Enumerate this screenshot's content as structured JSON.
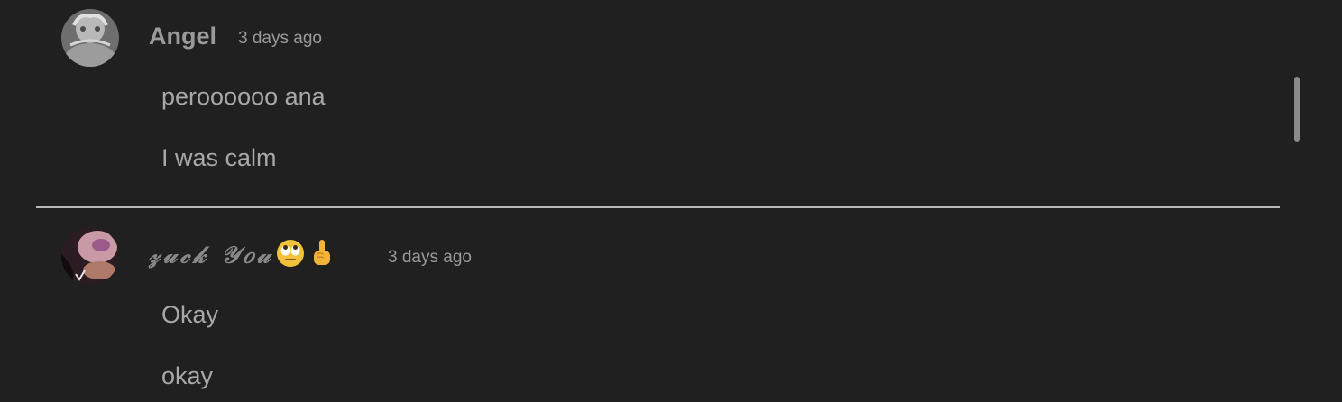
{
  "comments": [
    {
      "author": "Angel",
      "timestamp": "3 days ago",
      "avatar_icon": "user-photo-avatar",
      "lines": [
        "peroooooo ana",
        "I was calm"
      ]
    },
    {
      "author": "𝓏𝓊𝒸𝓀 𝒴𝑜𝓊",
      "author_emojis": [
        "face-with-rolling-eyes-emoji",
        "middle-finger-emoji"
      ],
      "timestamp": "3 days ago",
      "avatar_icon": "user-photo-avatar",
      "lines": [
        "Okay",
        "okay"
      ]
    }
  ],
  "colors": {
    "background": "#202020",
    "text_primary": "#a8a8a8",
    "text_secondary": "#9a9a9a",
    "divider": "#b8b8b8",
    "scrollbar": "#8a8a8a"
  }
}
